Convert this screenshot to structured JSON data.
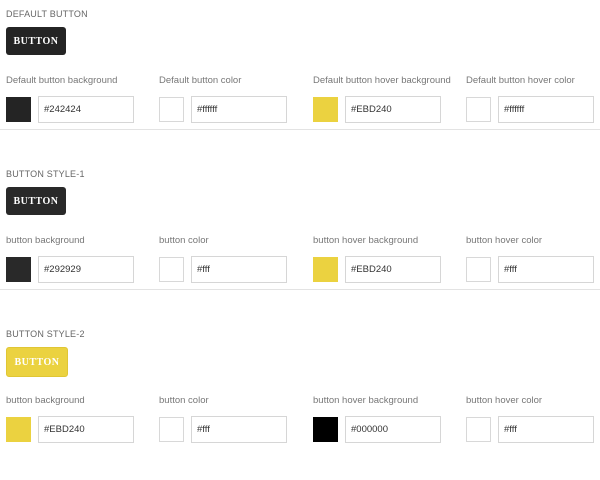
{
  "sections": [
    {
      "title": "DEFAULT BUTTON",
      "preview": {
        "label": "BUTTON",
        "bg": "#242424",
        "color": "#ffffff"
      },
      "fields": [
        {
          "label": "Default button background",
          "swatch": "#242424",
          "value": "#242424"
        },
        {
          "label": "Default button color",
          "swatch": "#ffffff",
          "value": "#ffffff"
        },
        {
          "label": "Default button hover background",
          "swatch": "#EBD240",
          "value": "#EBD240"
        },
        {
          "label": "Default button hover color",
          "swatch": "#ffffff",
          "value": "#ffffff"
        }
      ]
    },
    {
      "title": "BUTTON STYLE-1",
      "preview": {
        "label": "BUTTON",
        "bg": "#292929",
        "color": "#ffffff"
      },
      "fields": [
        {
          "label": "button background",
          "swatch": "#292929",
          "value": "#292929"
        },
        {
          "label": "button color",
          "swatch": "#ffffff",
          "value": "#fff"
        },
        {
          "label": "button hover background",
          "swatch": "#EBD240",
          "value": "#EBD240"
        },
        {
          "label": "button hover color",
          "swatch": "#ffffff",
          "value": "#fff"
        }
      ]
    },
    {
      "title": "BUTTON STYLE-2",
      "preview": {
        "label": "BUTTON",
        "bg": "#EBD240",
        "color": "#ffffff"
      },
      "fields": [
        {
          "label": "button background",
          "swatch": "#EBD240",
          "value": "#EBD240"
        },
        {
          "label": "button color",
          "swatch": "#ffffff",
          "value": "#fff"
        },
        {
          "label": "button hover background",
          "swatch": "#000000",
          "value": "#000000"
        },
        {
          "label": "button hover color",
          "swatch": "#ffffff",
          "value": "#fff"
        }
      ]
    }
  ]
}
